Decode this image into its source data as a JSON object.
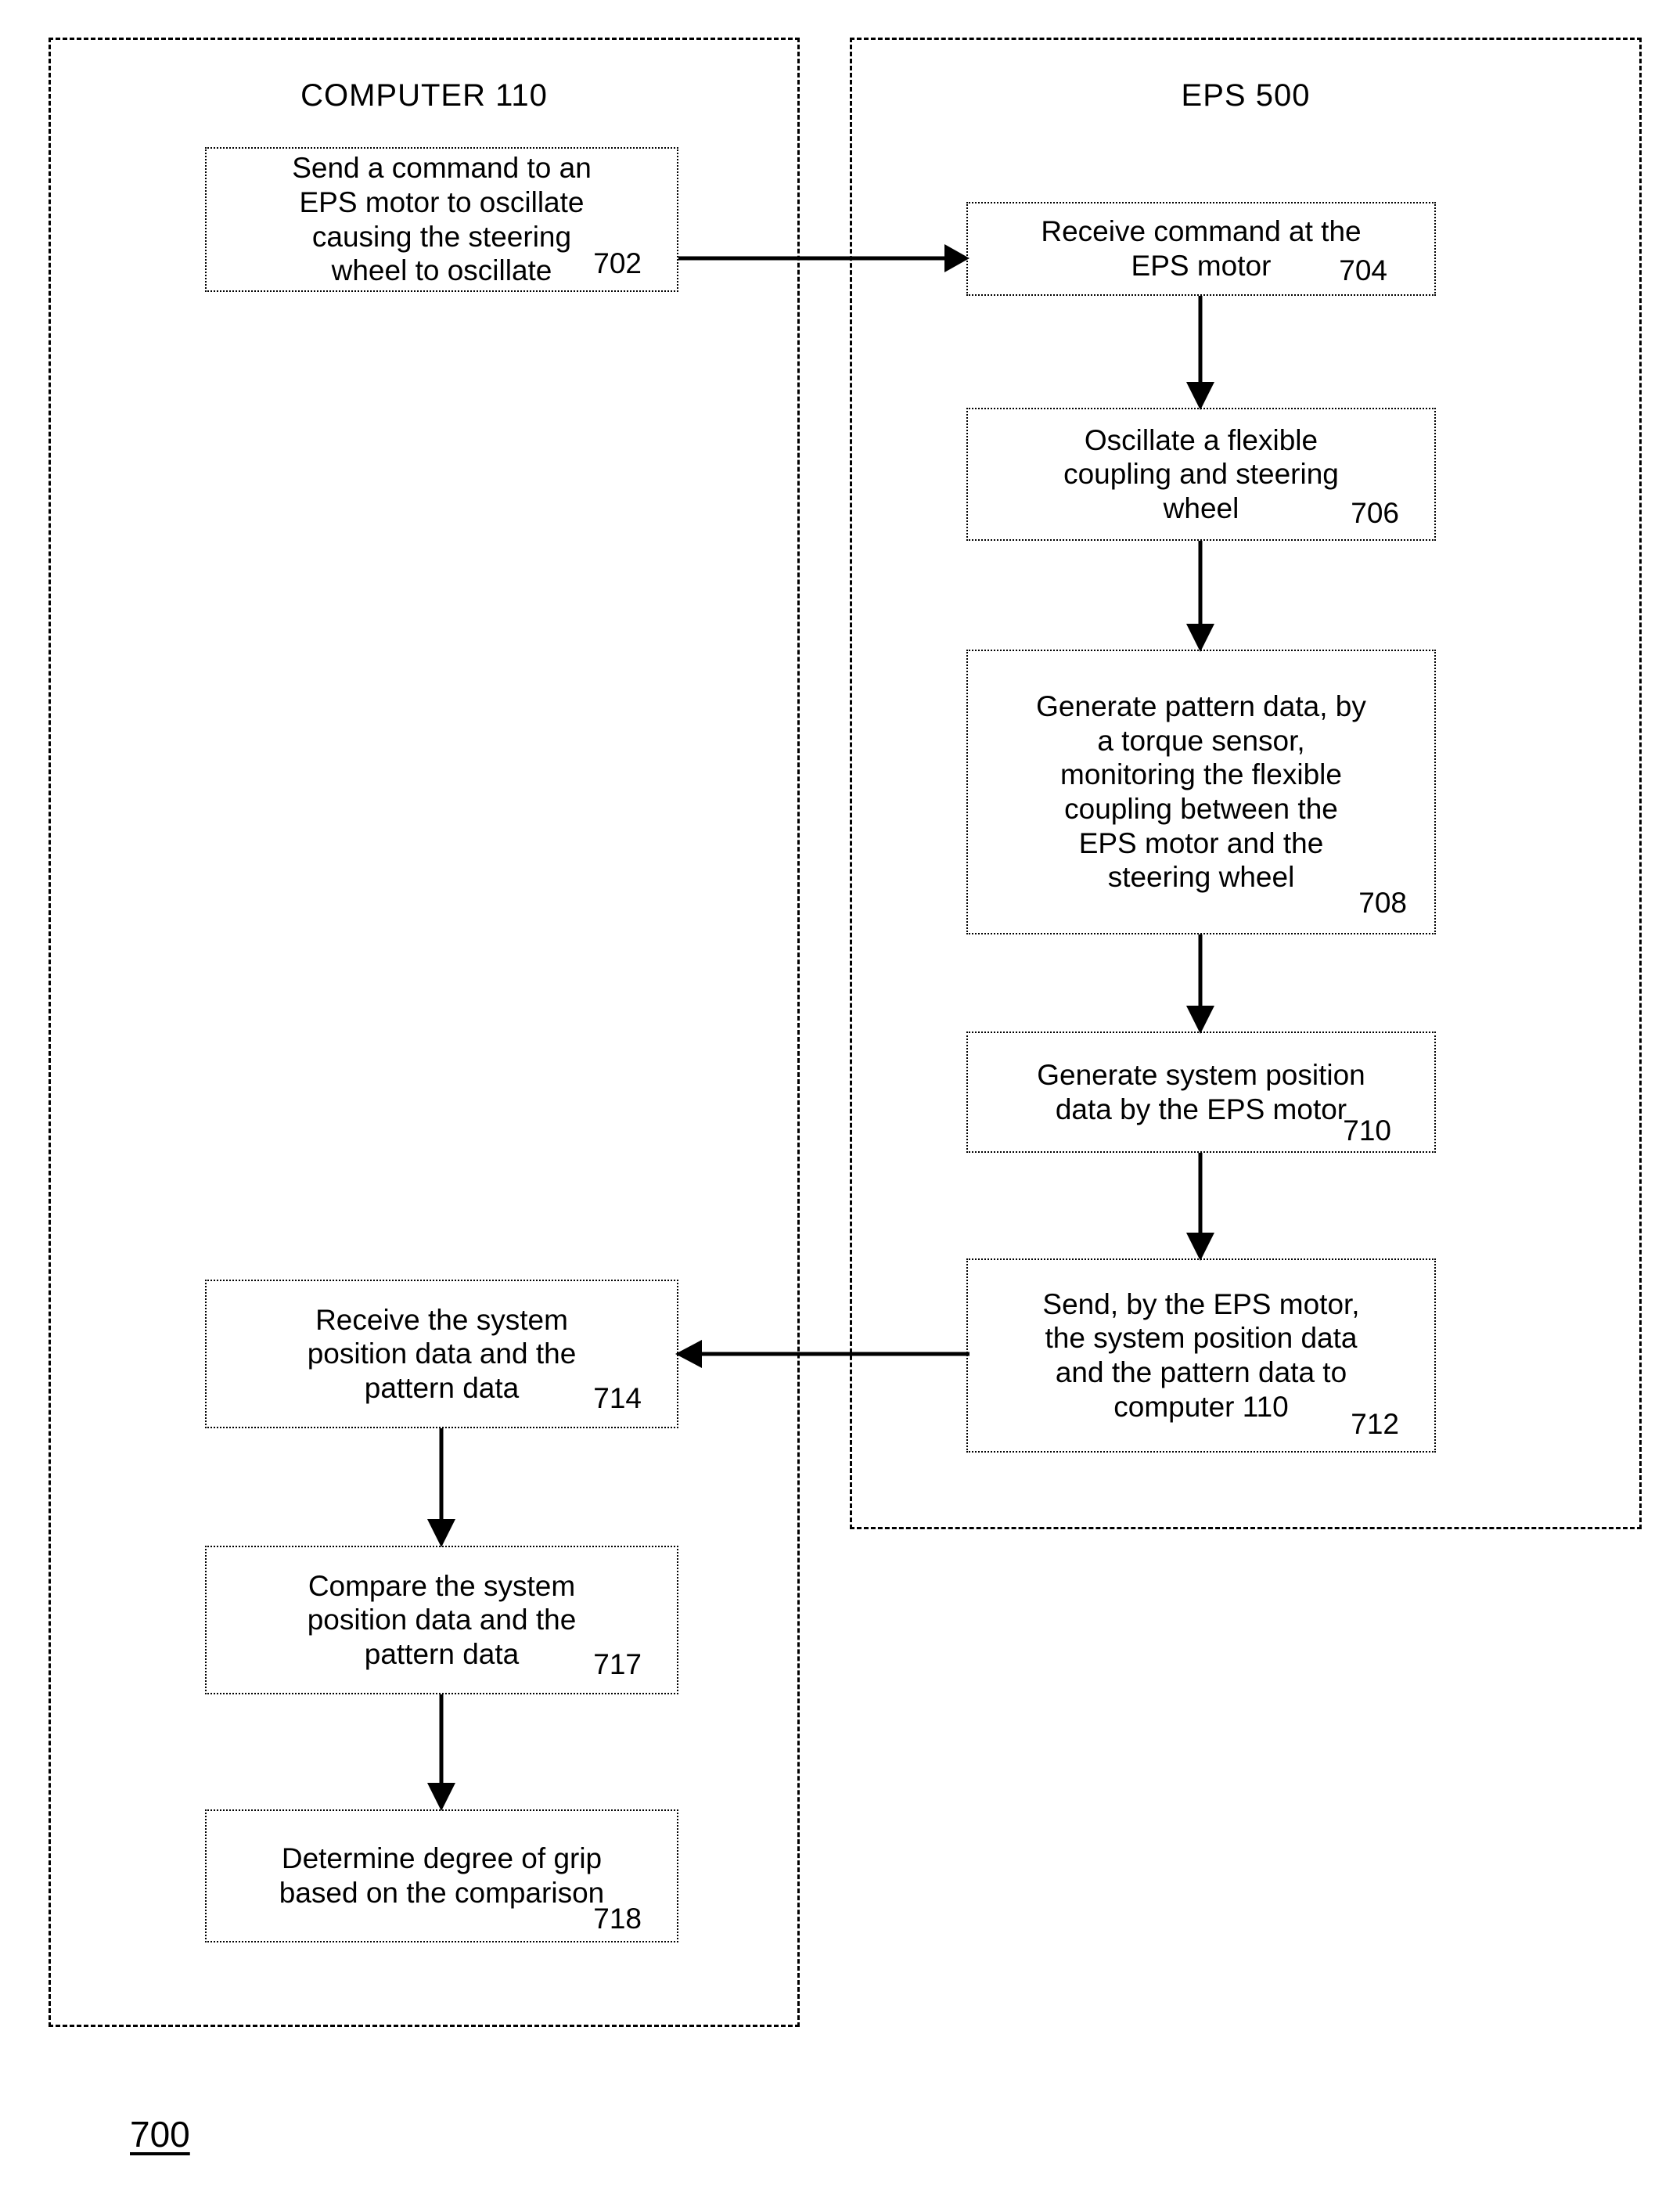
{
  "figure": {
    "label": "700"
  },
  "lanes": [
    {
      "id": "computer",
      "title": "COMPUTER 110"
    },
    {
      "id": "eps",
      "title": "EPS 500"
    }
  ],
  "nodes": [
    {
      "id": "n702",
      "lane": "computer",
      "ref": "702",
      "text": "Send a command to an\nEPS motor to oscillate\ncausing the steering\nwheel to oscillate"
    },
    {
      "id": "n704",
      "lane": "eps",
      "ref": "704",
      "text": "Receive command at the\nEPS motor"
    },
    {
      "id": "n706",
      "lane": "eps",
      "ref": "706",
      "text": "Oscillate a flexible\ncoupling and steering\nwheel"
    },
    {
      "id": "n708",
      "lane": "eps",
      "ref": "708",
      "text": "Generate pattern data, by\na torque sensor,\nmonitoring the flexible\ncoupling between the\nEPS motor and the\nsteering wheel"
    },
    {
      "id": "n710",
      "lane": "eps",
      "ref": "710",
      "text": "Generate system position\ndata by the EPS motor"
    },
    {
      "id": "n712",
      "lane": "eps",
      "ref": "712",
      "text": "Send, by the EPS motor,\nthe system position data\nand the pattern data to\ncomputer 110"
    },
    {
      "id": "n714",
      "lane": "computer",
      "ref": "714",
      "text": "Receive the system\nposition data and the\npattern data"
    },
    {
      "id": "n717",
      "lane": "computer",
      "ref": "717",
      "text": "Compare the system\nposition data and the\npattern data"
    },
    {
      "id": "n718",
      "lane": "computer",
      "ref": "718",
      "text": "Determine degree of grip\nbased on the comparison"
    }
  ],
  "connectors": [
    {
      "id": "c702-704",
      "from": "n702",
      "to": "n704",
      "direction": "right"
    },
    {
      "id": "c704-706",
      "from": "n704",
      "to": "n706",
      "direction": "down"
    },
    {
      "id": "c706-708",
      "from": "n706",
      "to": "n708",
      "direction": "down"
    },
    {
      "id": "c708-710",
      "from": "n708",
      "to": "n710",
      "direction": "down"
    },
    {
      "id": "c710-712",
      "from": "n710",
      "to": "n712",
      "direction": "down"
    },
    {
      "id": "c712-714",
      "from": "n712",
      "to": "n714",
      "direction": "left"
    },
    {
      "id": "c714-717",
      "from": "n714",
      "to": "n717",
      "direction": "down"
    },
    {
      "id": "c717-718",
      "from": "n717",
      "to": "n718",
      "direction": "down"
    }
  ]
}
